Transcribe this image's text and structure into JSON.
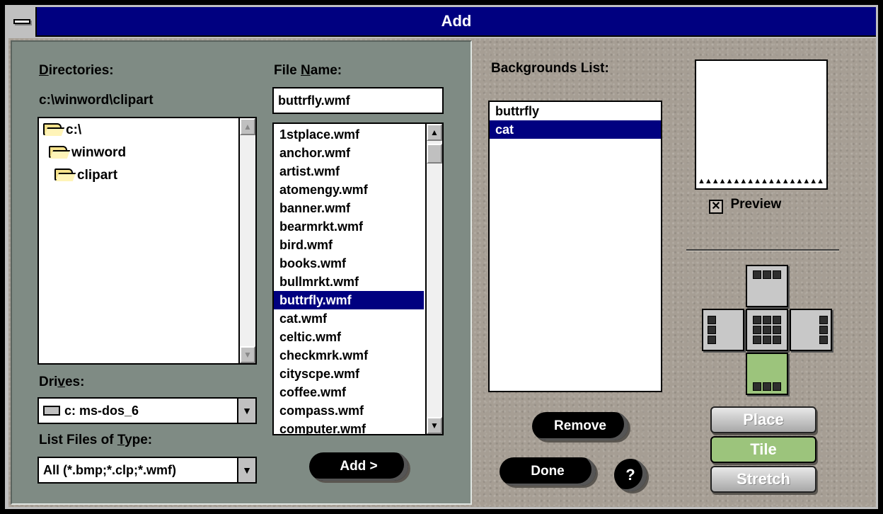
{
  "window": {
    "title": "Add"
  },
  "directories": {
    "label": "Directories:",
    "path": "c:\\winword\\clipart",
    "items": [
      "c:\\",
      "winword",
      "clipart"
    ]
  },
  "file_name": {
    "label": "File Name:",
    "value": "buttrfly.wmf",
    "files": [
      "1stplace.wmf",
      "anchor.wmf",
      "artist.wmf",
      "atomengy.wmf",
      "banner.wmf",
      "bearmrkt.wmf",
      "bird.wmf",
      "books.wmf",
      "bullmrkt.wmf",
      "buttrfly.wmf",
      "cat.wmf",
      "celtic.wmf",
      "checkmrk.wmf",
      "cityscpe.wmf",
      "coffee.wmf",
      "compass.wmf",
      "computer.wmf"
    ],
    "selected": "buttrfly.wmf"
  },
  "drives": {
    "label": "Drives:",
    "value": "c: ms-dos_6"
  },
  "file_type": {
    "label": "List Files of Type:",
    "value": "All (*.bmp;*.clp;*.wmf)"
  },
  "buttons": {
    "add": "Add >",
    "remove": "Remove",
    "done": "Done",
    "help": "?"
  },
  "backgrounds": {
    "label": "Backgrounds List:",
    "items": [
      "buttrfly",
      "cat"
    ],
    "selected": "cat"
  },
  "preview": {
    "label": "Preview",
    "checked": true
  },
  "modes": {
    "items": [
      "Place",
      "Tile",
      "Stretch"
    ],
    "selected": "Tile"
  },
  "position_selector": {
    "selected": "bottom"
  },
  "colors": {
    "titlebar": "#000080",
    "selection": "#000080",
    "panel": "#7f8b84",
    "accent_green": "#9cc47c"
  }
}
